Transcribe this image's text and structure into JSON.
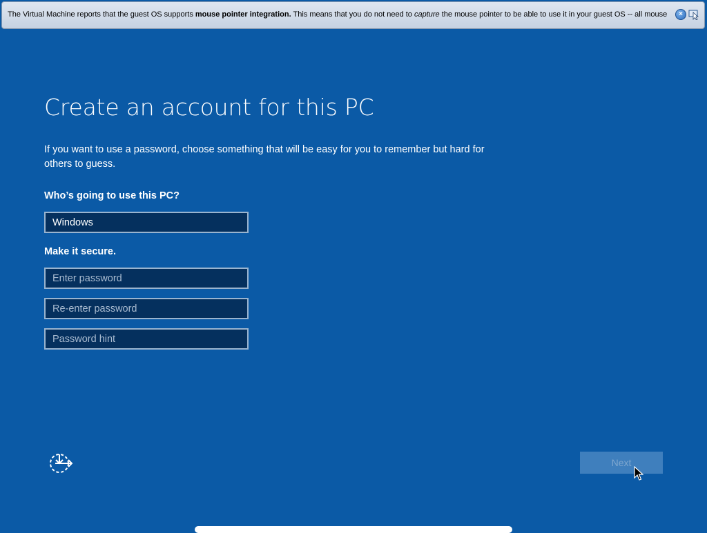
{
  "banner": {
    "text_before": "The Virtual Machine reports that the guest OS supports ",
    "text_bold": "mouse pointer integration.",
    "text_mid": " This means that you do not need to ",
    "text_italic": "capture",
    "text_after": " the mouse pointer to be able to use it in your guest OS -- all mouse",
    "close_icon": "close-icon",
    "pin_icon": "mouse-integration-icon"
  },
  "page": {
    "title": "Create an account for this PC",
    "description": "If you want to use a password, choose something that will be easy for you to remember but hard for others to guess.",
    "who_label": "Who’s going to use this PC?",
    "username_value": "Windows",
    "secure_label": "Make it secure.",
    "password_placeholder": "Enter password",
    "reenter_placeholder": "Re-enter password",
    "hint_placeholder": "Password hint"
  },
  "footer": {
    "ease_icon": "ease-of-access-icon",
    "next_label": "Next"
  },
  "colors": {
    "background": "#0b5aa6",
    "field_background": "#05305e",
    "next_button": "#3f7fbd"
  }
}
